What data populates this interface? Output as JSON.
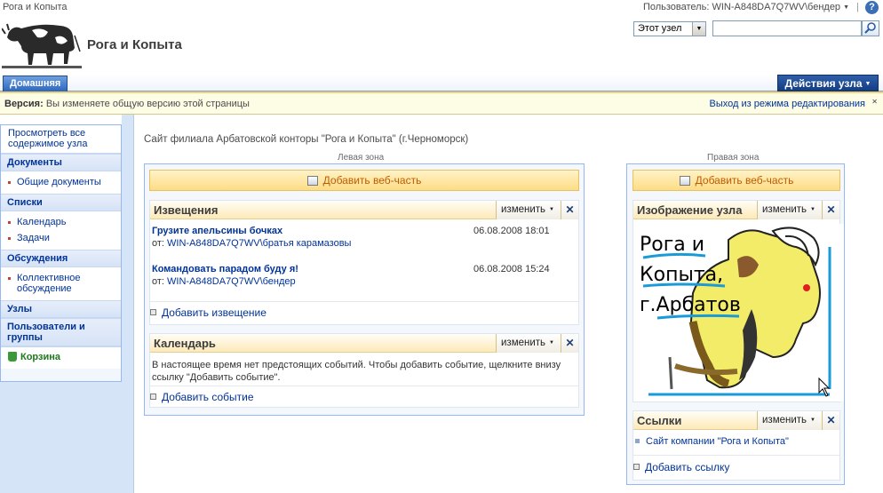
{
  "topbar": {
    "site_name": "Рога и Копыта",
    "user": "Пользователь: WIN-A848DA7Q7WV\\бендер",
    "separator": "|",
    "help": "?"
  },
  "header": {
    "site_title": "Рога и Копыта",
    "scope_value": "Этот узел",
    "search_placeholder": ""
  },
  "nav": {
    "home_tab": "Домашняя",
    "site_actions": "Действия узла"
  },
  "version_bar": {
    "label": "Версия:",
    "message": "Вы изменяете общую версию этой страницы",
    "exit_link": "Выход из режима редактирования",
    "close": "✕"
  },
  "leftnav": {
    "view_all": "Просмотреть все содержимое узла",
    "documents_header": "Документы",
    "documents": [
      "Общие документы"
    ],
    "lists_header": "Списки",
    "lists": [
      "Календарь",
      "Задачи"
    ],
    "discussions_header": "Обсуждения",
    "discussions": [
      "Коллективное обсуждение"
    ],
    "sites_header": "Узлы",
    "people_header": "Пользователи и группы",
    "recycle_bin": "Корзина"
  },
  "page": {
    "description": "Сайт филиала Арбатовской конторы \"Рога и Копыта\" (г.Черноморск)",
    "left_zone_label": "Левая зона",
    "right_zone_label": "Правая зона",
    "add_webpart": "Добавить веб-часть"
  },
  "webparts": {
    "edit_label": "изменить",
    "close_label": "✕",
    "announcements": {
      "title": "Извещения",
      "items": [
        {
          "title": "Грузите апельсины бочках",
          "date": "06.08.2008 18:01",
          "from_label": "от:",
          "author": "WIN-A848DA7Q7WV\\братья карамазовы"
        },
        {
          "title": "Командовать парадом буду я!",
          "date": "06.08.2008 15:24",
          "from_label": "от:",
          "author": "WIN-A848DA7Q7WV\\бендер"
        }
      ],
      "add": "Добавить извещение"
    },
    "calendar": {
      "title": "Календарь",
      "empty": "В настоящее время нет предстоящих событий. Чтобы добавить событие, щелкните внизу ссылку \"Добавить событие\".",
      "add": "Добавить событие"
    },
    "site_image": {
      "title": "Изображение узла",
      "text_lines": [
        "Рога и",
        "Копыта,",
        "г.Арбатов"
      ]
    },
    "links": {
      "title": "Ссылки",
      "items": [
        "Сайт компании \"Рога и Копыта\""
      ],
      "add": "Добавить ссылку"
    }
  },
  "colors": {
    "link": "#003399",
    "tab_blue": "#2d66be",
    "webpart_header": "#fde9b8",
    "version_bar": "#fdfce4"
  }
}
